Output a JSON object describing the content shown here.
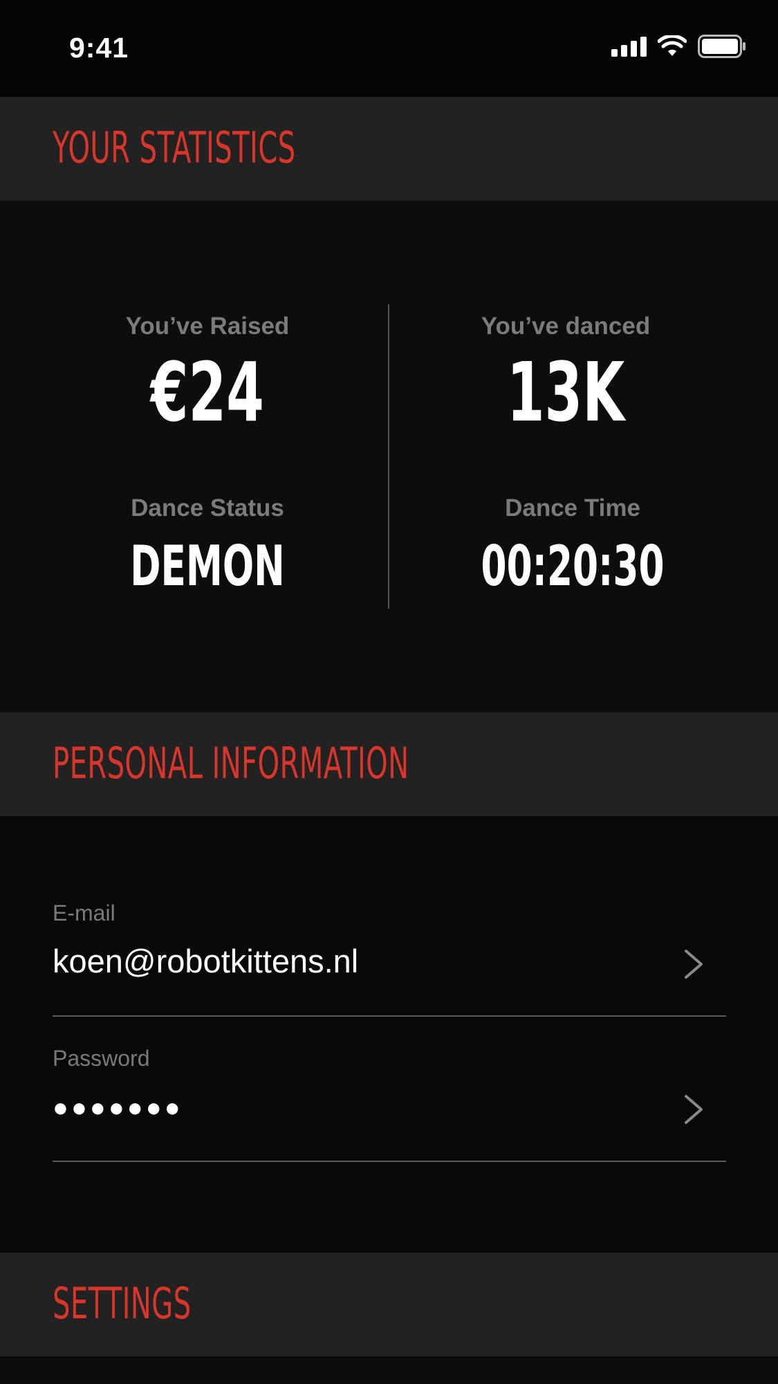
{
  "status_bar": {
    "time": "9:41",
    "icons": [
      "cellular-signal-icon",
      "wifi-icon",
      "battery-icon"
    ]
  },
  "sections": {
    "statistics_title": "YOUR STATISTICS",
    "personal_title": "PERSONAL INFORMATION",
    "settings_title": "SETTINGS"
  },
  "stats": {
    "raised_label": "You’ve Raised",
    "raised_value": "€24",
    "danced_label": "You’ve danced",
    "danced_value": "13K",
    "status_label": "Dance Status",
    "status_value": "DEMON",
    "time_label": "Dance Time",
    "time_value": "00:20:30"
  },
  "personal": {
    "email_label": "E-mail",
    "email_value": "koen@robotkittens.nl",
    "password_label": "Password",
    "password_value": "●●●●●●●"
  },
  "colors": {
    "accent": "#d8362b",
    "header_bg": "#222222",
    "background": "#0b0b0b",
    "label_gray": "#7b7b7b"
  }
}
